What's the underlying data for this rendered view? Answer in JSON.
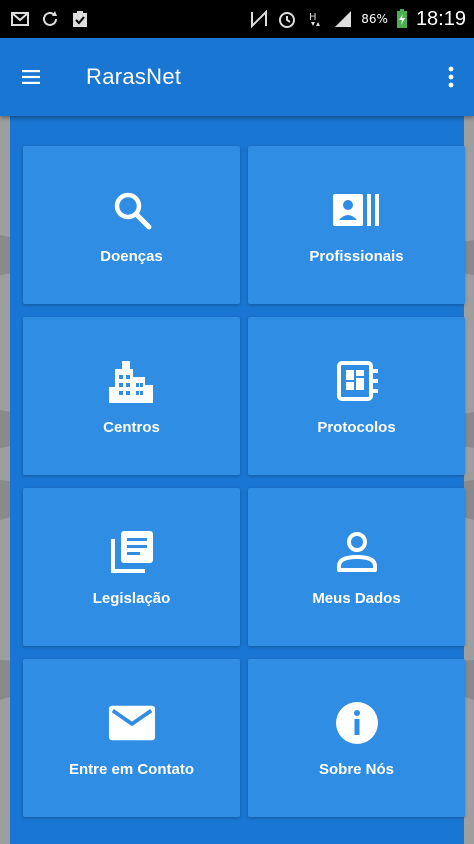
{
  "status_bar": {
    "battery_percent": "86%",
    "time": "18:19",
    "icons": [
      "mail-icon",
      "sync-icon",
      "clipboard-icon",
      "nfc-icon",
      "alarm-icon",
      "hspa-icon",
      "signal-icon",
      "battery-charging-icon"
    ]
  },
  "app_bar": {
    "title": "RarasNet",
    "menu_icon": "hamburger-menu-icon",
    "overflow_icon": "overflow-menu-icon"
  },
  "tiles": [
    {
      "label": "Doenças",
      "icon": "search-icon"
    },
    {
      "label": "Profissionais",
      "icon": "contact-card-icon"
    },
    {
      "label": "Centros",
      "icon": "building-icon"
    },
    {
      "label": "Protocolos",
      "icon": "protocol-icon"
    },
    {
      "label": "Legislação",
      "icon": "library-books-icon"
    },
    {
      "label": "Meus Dados",
      "icon": "person-icon"
    },
    {
      "label": "Entre em Contato",
      "icon": "mail-icon"
    },
    {
      "label": "Sobre Nós",
      "icon": "info-icon"
    }
  ],
  "colors": {
    "primary": "#1976d2",
    "tile": "#2f8de4",
    "status_bar": "#000000",
    "text": "#ffffff"
  }
}
